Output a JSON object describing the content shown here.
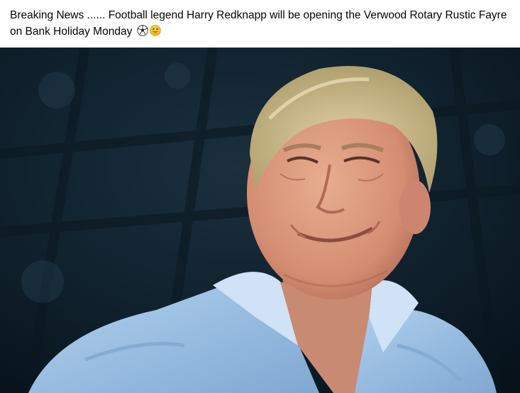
{
  "post": {
    "text": "Breaking News ...... Football legend Harry Redknapp will be opening the Verwood Rotary Rustic Fayre on Bank Holiday Monday",
    "emojis": [
      "soccer-ball-icon",
      "smiling-face-icon"
    ]
  },
  "photo": {
    "subject": "smiling-man-portrait",
    "colors": {
      "background": "#0d1d29",
      "shirt": "#9fc3e6",
      "skin": "#d89a7e",
      "hair": "#c9b98c"
    }
  }
}
